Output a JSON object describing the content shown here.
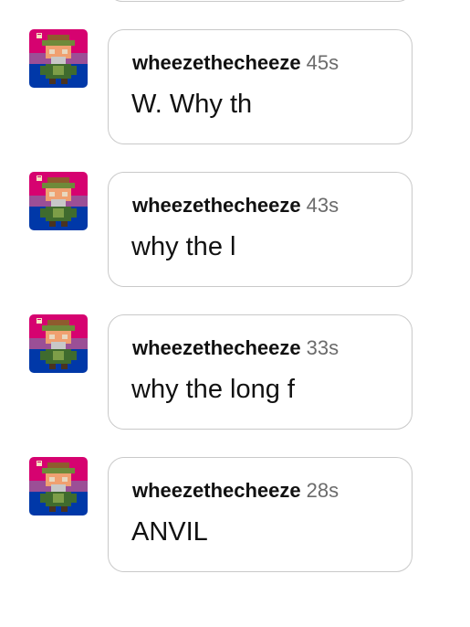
{
  "messages": [
    {
      "username": "wheezethecheeze",
      "time": "45s",
      "text": "W. Why th",
      "avatar": "pixel-avatar-icon"
    },
    {
      "username": "wheezethecheeze",
      "time": "43s",
      "text": "why the l",
      "avatar": "pixel-avatar-icon"
    },
    {
      "username": "wheezethecheeze",
      "time": "33s",
      "text": "why the long f",
      "avatar": "pixel-avatar-icon"
    },
    {
      "username": "wheezethecheeze",
      "time": "28s",
      "text": "ANVIL",
      "avatar": "pixel-avatar-icon"
    }
  ],
  "colors": {
    "flag_pink": "#d60270",
    "flag_purple": "#9b4f96",
    "flag_blue": "#0038a8",
    "bubble_border": "#c9c9c9",
    "timestamp": "#6b6b6b"
  }
}
